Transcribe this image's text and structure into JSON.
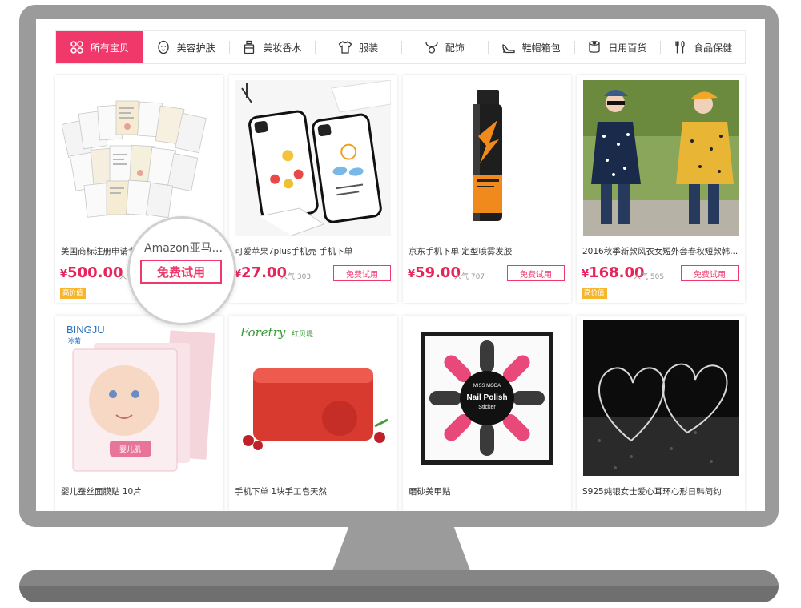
{
  "tabs": [
    {
      "label": "所有宝贝",
      "icon": "grid-icon"
    },
    {
      "label": "美容护肤",
      "icon": "face-icon"
    },
    {
      "label": "美妆香水",
      "icon": "perfume-icon"
    },
    {
      "label": "服装",
      "icon": "shirt-icon"
    },
    {
      "label": "配饰",
      "icon": "necklace-icon"
    },
    {
      "label": "鞋帽箱包",
      "icon": "high-heel-icon"
    },
    {
      "label": "日用百货",
      "icon": "tissue-roll-icon"
    },
    {
      "label": "食品保健",
      "icon": "cutlery-icon"
    }
  ],
  "colors": {
    "accent": "#f0386b",
    "price": "#e8245d",
    "tag": "#f7b52c",
    "frame": "#9b9b9b"
  },
  "currency": "¥",
  "products": [
    {
      "title": "美国商标注册申请专",
      "price": "500.00",
      "pop_label": "人气",
      "pop": "",
      "button": "免费试用",
      "tag": "高价值",
      "image": "document-stack-image"
    },
    {
      "title": "可爱苹果7plus手机壳 手机下单",
      "price": "27.00",
      "pop_label": "人气",
      "pop": "303",
      "button": "免费试用",
      "tag": "",
      "image": "phone-cases-image"
    },
    {
      "title": "京东手机下单 定型喷雾发胶",
      "price": "59.00",
      "pop_label": "人气",
      "pop": "707",
      "button": "免费试用",
      "tag": "",
      "image": "hairspray-image"
    },
    {
      "title": "2016秋季新款风衣女短外套春秋短款韩...",
      "price": "168.00",
      "pop_label": "人气",
      "pop": "505",
      "button": "免费试用",
      "tag": "高价值",
      "image": "jacket-models-image"
    },
    {
      "title": "婴儿蚕丝面膜贴 10片",
      "image": "face-mask-image",
      "brand": "BINGJU",
      "brand_sub": "冰菊",
      "pack_label": "婴儿肌"
    },
    {
      "title": "手机下单 1块手工皂天然",
      "image": "soap-image",
      "brand": "Foretry",
      "brand_sub": "红贝堤"
    },
    {
      "title": "磨砂美甲贴",
      "image": "nail-sticker-image",
      "brand": "MISS MODA",
      "label": "Nail Polish",
      "label_sub": "Sticker"
    },
    {
      "title": "S925纯银女士爱心耳环心形日韩简约",
      "image": "heart-earrings-image"
    }
  ],
  "magnifier": {
    "text": "Amazon亚马...",
    "button": "免费试用"
  }
}
